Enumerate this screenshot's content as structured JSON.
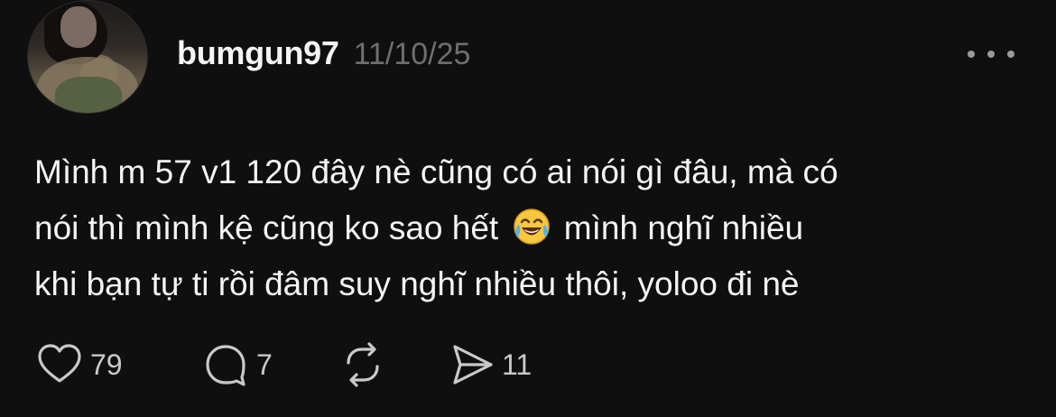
{
  "post": {
    "username": "bumgun97",
    "date": "11/10/25",
    "text_lines": [
      "Mình m 57 v1 120 đây nè cũng có ai nói gì đâu, mà có",
      "nói thì mình kệ cũng ko sao hết",
      " mình nghĩ nhiều",
      "khi bạn tự ti rồi đâm suy nghĩ nhiều thôi, yoloo đi nè"
    ],
    "emoji": "face-with-tears-of-joy"
  },
  "actions": {
    "likes": "79",
    "replies": "7",
    "shares": "11"
  },
  "icons": {
    "like": "heart-icon",
    "reply": "speech-bubble-icon",
    "repost": "repost-icon",
    "share": "send-icon",
    "more": "more-options-icon"
  },
  "colors": {
    "background": "#0f0f10",
    "text": "#f3f5f7",
    "muted": "#6f6f6f",
    "icon": "#c9c9c9"
  }
}
